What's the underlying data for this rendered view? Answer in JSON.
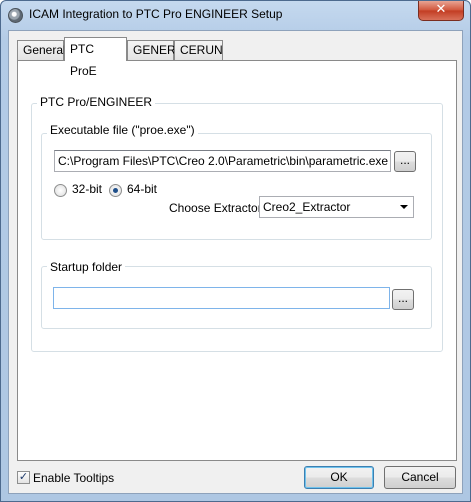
{
  "window": {
    "title": "ICAM Integration to PTC Pro ENGINEER Setup",
    "close_glyph": "✕"
  },
  "tabs": [
    {
      "label": "General"
    },
    {
      "label": "PTC ProE"
    },
    {
      "label": "GENER"
    },
    {
      "label": "CERUN"
    }
  ],
  "panel": {
    "group_title": "PTC Pro/ENGINEER",
    "executable": {
      "group_title": "Executable file (\"proe.exe\")",
      "path_value": "C:\\Program Files\\PTC\\Creo 2.0\\Parametric\\bin\\parametric.exe",
      "browse_label": "...",
      "radio_32_label": "32-bit",
      "radio_64_label": "64-bit",
      "selected_arch": "64-bit",
      "extractor_label": "Choose Extractor:",
      "extractor_value": "Creo2_Extractor"
    },
    "startup": {
      "group_title": "Startup folder",
      "path_value": "",
      "browse_label": "..."
    }
  },
  "footer": {
    "tooltips_label": "Enable Tooltips",
    "tooltips_checked": true,
    "ok_label": "OK",
    "cancel_label": "Cancel"
  },
  "icons": {
    "app_icon": "gear-icon",
    "close_icon": "close-icon",
    "dropdown_icon": "chevron-down-icon",
    "check_glyph": "✓"
  }
}
